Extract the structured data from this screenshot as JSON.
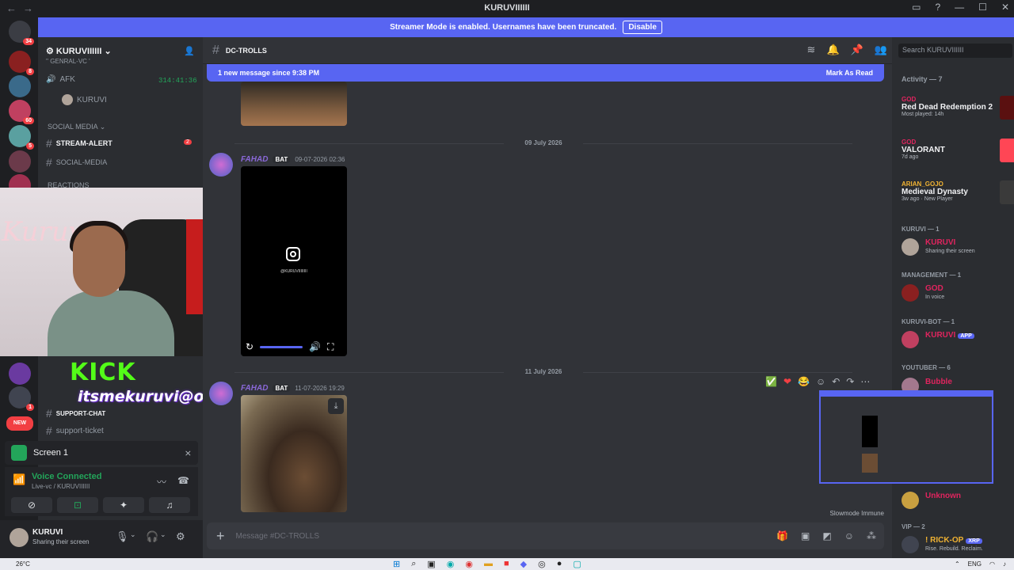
{
  "titlebar": {
    "title": "KURUVIIIIII",
    "back": "←",
    "forward": "→"
  },
  "banner": {
    "text": "Streamer Mode is enabled. Usernames have been truncated.",
    "button": "Disable"
  },
  "servers": {
    "home_badge": "34",
    "badges": [
      "8",
      "60",
      "5",
      "1",
      "NEW"
    ]
  },
  "guild": {
    "name": "KURUVIIIIII"
  },
  "channels": {
    "truncated_top": "'' GENRAL-VC '",
    "afk_label": "AFK",
    "afk_timer": "314:41:36",
    "afk_user": "KURUVI",
    "social_category": "SOCIAL MEDIA",
    "stream_alert": "STREAM-ALERT",
    "stream_alert_badge": "2",
    "social_media": "SOCIAL-MEDIA",
    "reactions_category": "REACTIONS",
    "support_chat": "SUPPORT-CHAT",
    "support_ticket": "support-ticket"
  },
  "overlay": {
    "kick": "KICK",
    "handle": "itsmekuruvi@oksbi",
    "sign": "Kuruviii"
  },
  "screen": {
    "label": "Screen 1"
  },
  "voice": {
    "status": "Voice Connected",
    "channel": "Live-vc / KURUVIIIIII"
  },
  "user": {
    "name": "KURUVI",
    "status": "Sharing their screen"
  },
  "chat": {
    "channel_name": "DC-TROLLS",
    "new_message_text": "1 new message since 9:38 PM",
    "mark_read": "Mark As Read",
    "date1": "09 July 2026",
    "date2": "11 July 2026",
    "author": "FAHAD",
    "bot_tag": "BAT",
    "ts1": "09-07-2026 02:36",
    "ts2": "11-07-2026 19:29",
    "ig_user": "@KURUVIIIIIIII",
    "slowmode": "Slowmode Immune",
    "composer_placeholder": "Message #DC-TROLLS"
  },
  "right": {
    "search_placeholder": "Search KURUVIIIIII",
    "activity_label": "Activity — 7",
    "activities": [
      {
        "user": "GOD",
        "game": "Red Dead Redemption 2",
        "sub": "Most played: 14h"
      },
      {
        "user": "GOD",
        "game": "VALORANT",
        "sub": "7d ago"
      },
      {
        "user": "ARIAN_GOJO",
        "game": "Medieval Dynasty",
        "sub": "3w ago · New Player"
      }
    ],
    "groups": [
      {
        "label": "KURUVI — 1",
        "name": "KURUVI",
        "status": "Sharing their screen"
      },
      {
        "label": "MANAGEMENT — 1",
        "name": "GOD",
        "status": "In voice"
      },
      {
        "label": "KURUVI-BOT — 1",
        "name": "KURUVI",
        "status": "",
        "app": "APP"
      },
      {
        "label": "YOUTUBER — 6",
        "name": "Bubble",
        "status": ""
      }
    ],
    "unknown_name": "Unknown",
    "vip_label": "VIP — 2",
    "vip_member": "! RICK-OP",
    "vip_tag": "XRP",
    "vip_status": "Rise. Rebuild. Reclaim."
  },
  "taskbar": {
    "weather": "26°C",
    "lang": "ENG"
  },
  "colors": {
    "accent": "#5865f2",
    "kick": "#53fc18",
    "online": "#23a55a",
    "danger": "#f23f43"
  }
}
